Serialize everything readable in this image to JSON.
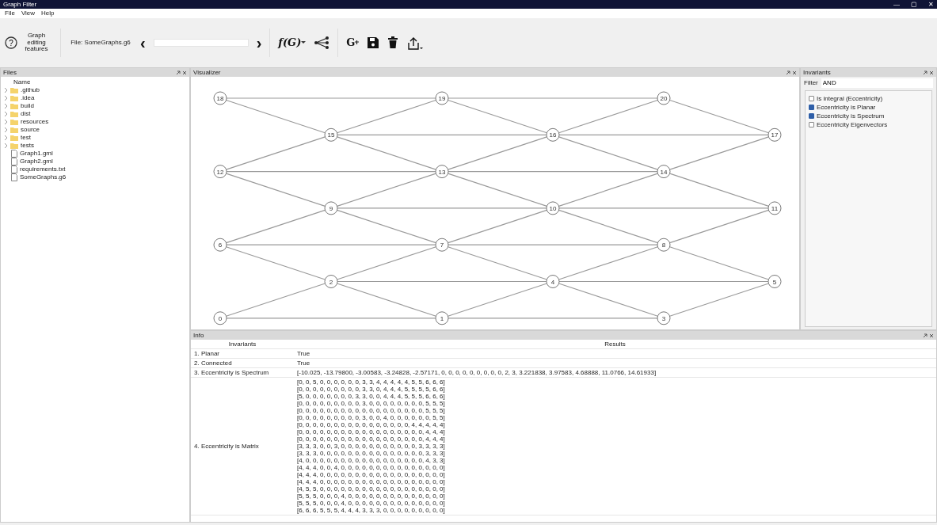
{
  "window": {
    "title": "Graph Filter",
    "controls": [
      "—",
      "▢",
      "✕"
    ]
  },
  "menu": [
    "File",
    "View",
    "Help"
  ],
  "toolbar": {
    "help_icon": "?",
    "help_label": "Graph editing features",
    "file_label": "File: SomeGraphs.g6",
    "prev": "‹",
    "next": "›",
    "function": "f(G)",
    "add_graph": "G"
  },
  "files_panel": {
    "title": "Files",
    "header": "Name",
    "items": [
      {
        "name": ".github",
        "kind": "folder"
      },
      {
        "name": ".idea",
        "kind": "folder"
      },
      {
        "name": "build",
        "kind": "folder"
      },
      {
        "name": "dist",
        "kind": "folder"
      },
      {
        "name": "resources",
        "kind": "folder"
      },
      {
        "name": "source",
        "kind": "folder"
      },
      {
        "name": "test",
        "kind": "folder"
      },
      {
        "name": "tests",
        "kind": "folder"
      },
      {
        "name": "Graph1.gml",
        "kind": "file"
      },
      {
        "name": "Graph2.gml",
        "kind": "file"
      },
      {
        "name": "requirements.txt",
        "kind": "file"
      },
      {
        "name": "SomeGraphs.g6",
        "kind": "file"
      }
    ]
  },
  "visualizer": {
    "title": "Visualizer",
    "nodes": [
      "18",
      "19",
      "20",
      "15",
      "16",
      "17",
      "12",
      "13",
      "14",
      "9",
      "10",
      "11",
      "6",
      "7",
      "8",
      "2",
      "4",
      "5",
      "0",
      "1",
      "3"
    ]
  },
  "invariants_panel": {
    "title": "Invariants",
    "filter_label": "Filter",
    "filter_value": "AND",
    "items": [
      {
        "label": "Is integral (Eccentricity)",
        "checked": false
      },
      {
        "label": "Eccentricity is Planar",
        "checked": true
      },
      {
        "label": "Eccentricity is Spectrum",
        "checked": true
      },
      {
        "label": "Eccentricity Eigenvectors",
        "checked": false
      }
    ]
  },
  "info_panel": {
    "title": "Info",
    "columns": [
      "Invariants",
      "Results"
    ],
    "rows": [
      {
        "invariant": "1. Planar",
        "result": [
          "True"
        ]
      },
      {
        "invariant": "2. Connected",
        "result": [
          "True"
        ]
      },
      {
        "invariant": "3. Eccentricity is Spectrum",
        "result": [
          "[-10.025, -13.79800, -3.00583, -3.24828, -2.57171, 0, 0, 0, 0, 0, 0, 0, 0, 0, 2, 3, 3.221838, 3.97583, 4.68888, 11.0766, 14.61933]"
        ]
      },
      {
        "invariant": "4. Eccentricity is Matrix",
        "result": [
          "[0, 0, 5, 0, 0, 0, 0, 0, 0, 3, 3, 4, 4, 4, 4, 4, 5, 5, 6, 6, 6]",
          "[0, 0, 0, 0, 0, 0, 0, 0, 0, 3, 3, 0, 4, 4, 4, 5, 5, 5, 5, 6, 6]",
          "[5, 0, 0, 0, 0, 0, 0, 0, 3, 3, 0, 0, 4, 4, 4, 5, 5, 5, 6, 6, 6]",
          "[0, 0, 0, 0, 0, 0, 0, 0, 0, 3, 0, 0, 0, 0, 0, 0, 0, 0, 5, 5, 5]",
          "[0, 0, 0, 0, 0, 0, 0, 0, 0, 0, 0, 0, 0, 0, 0, 0, 0, 0, 5, 5, 5]",
          "[0, 0, 0, 0, 0, 0, 0, 0, 0, 3, 0, 0, 4, 0, 0, 0, 0, 0, 0, 5, 5]",
          "[0, 0, 0, 0, 0, 0, 0, 0, 0, 0, 0, 0, 0, 0, 0, 0, 4, 4, 4, 4, 4]",
          "[0, 0, 0, 0, 0, 0, 0, 0, 0, 0, 0, 0, 0, 0, 0, 0, 0, 0, 4, 4, 4]",
          "[0, 0, 0, 0, 0, 0, 0, 0, 0, 0, 0, 0, 0, 0, 0, 0, 0, 0, 4, 4, 4]",
          "[3, 3, 3, 0, 0, 3, 0, 0, 0, 0, 0, 0, 0, 0, 0, 0, 0, 3, 3, 3, 3]",
          "[3, 3, 3, 0, 0, 0, 0, 0, 0, 0, 0, 0, 0, 0, 0, 0, 0, 0, 3, 3, 3]",
          "[4, 0, 0, 0, 0, 0, 0, 0, 0, 0, 0, 0, 0, 0, 0, 0, 0, 0, 4, 3, 3]",
          "[4, 4, 4, 0, 0, 4, 0, 0, 0, 0, 0, 0, 0, 0, 0, 0, 0, 0, 0, 0, 0]",
          "[4, 4, 4, 0, 0, 0, 0, 0, 0, 0, 0, 0, 0, 0, 0, 0, 0, 0, 0, 0, 0]",
          "[4, 4, 4, 0, 0, 0, 0, 0, 0, 0, 0, 0, 0, 0, 0, 0, 0, 0, 0, 0, 0]",
          "[4, 5, 5, 0, 0, 0, 0, 0, 0, 0, 0, 0, 0, 0, 0, 0, 0, 0, 0, 0, 0]",
          "[5, 5, 5, 0, 0, 0, 4, 0, 0, 0, 0, 0, 0, 0, 0, 0, 0, 0, 0, 0, 0]",
          "[5, 5, 5, 0, 0, 0, 4, 0, 0, 0, 0, 0, 0, 0, 0, 0, 0, 0, 0, 0, 0]",
          "[6, 6, 6, 5, 5, 5, 4, 4, 4, 3, 3, 3, 0, 0, 0, 0, 0, 0, 0, 0, 0]"
        ]
      }
    ]
  }
}
